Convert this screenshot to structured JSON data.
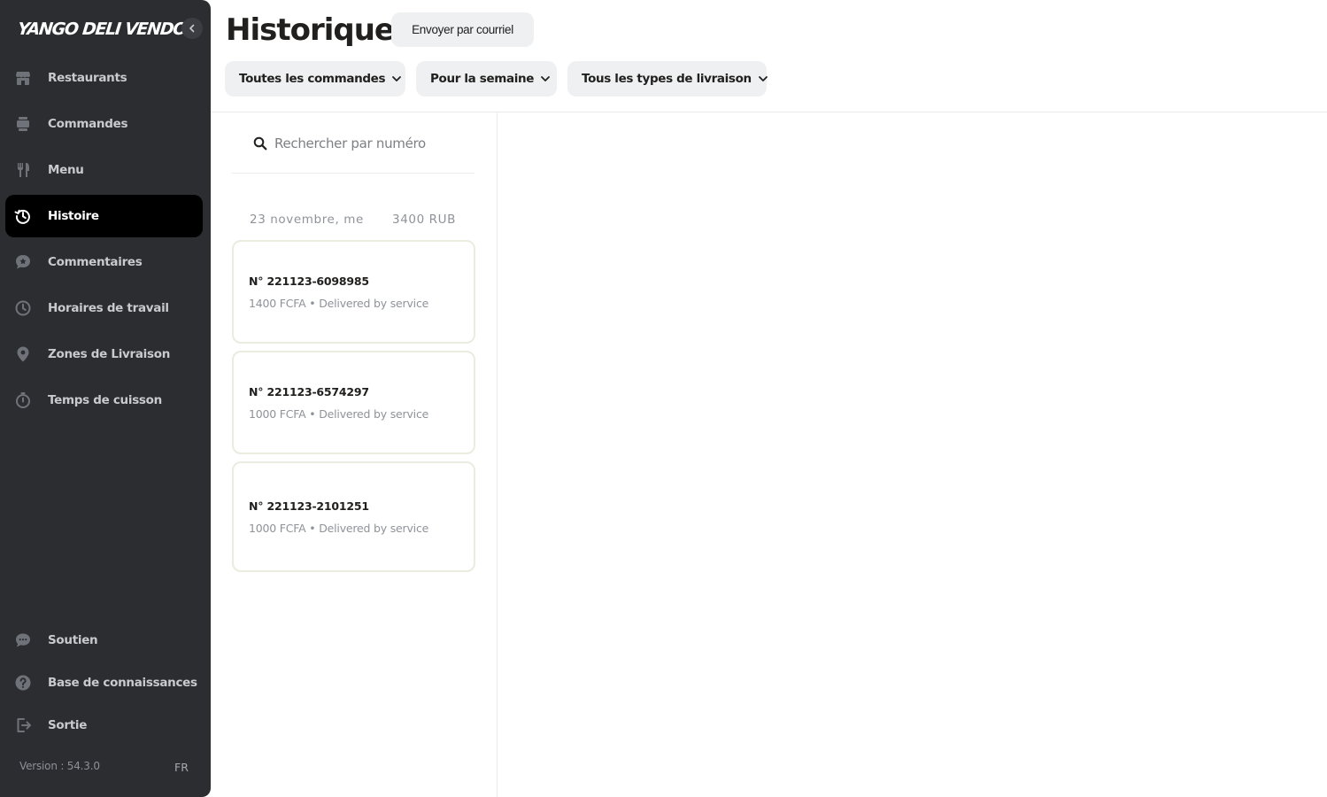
{
  "sidebar": {
    "brand": "YANGO DELI VENDOR",
    "items": [
      {
        "label": "Restaurants",
        "icon": "store-icon"
      },
      {
        "label": "Commandes",
        "icon": "orders-stack-icon"
      },
      {
        "label": "Menu",
        "icon": "fork-knife-icon"
      },
      {
        "label": "Histoire",
        "icon": "history-icon",
        "active": true
      },
      {
        "label": "Commentaires",
        "icon": "comment-star-icon"
      },
      {
        "label": "Horaires de travail",
        "icon": "clock-icon"
      },
      {
        "label": "Zones de Livraison",
        "icon": "location-pin-icon"
      },
      {
        "label": "Temps de cuisson",
        "icon": "stopwatch-icon"
      }
    ],
    "bottom_items": [
      {
        "label": "Soutien",
        "icon": "chat-bubble-icon"
      },
      {
        "label": "Base de connaissances",
        "icon": "help-circle-icon"
      },
      {
        "label": "Sortie",
        "icon": "logout-icon"
      }
    ],
    "version": "Version : 54.3.0",
    "language": "FR"
  },
  "header": {
    "title": "Historique",
    "email_button": "Envoyer par courriel",
    "filters": [
      "Toutes les commandes",
      "Pour la semaine",
      "Tous les types de livraison"
    ]
  },
  "search": {
    "placeholder": "Rechercher par numéro",
    "value": ""
  },
  "group": {
    "date": "23 novembre, me",
    "total": "3400 RUB"
  },
  "orders": [
    {
      "number": "N° 221123-6098985",
      "amount": "1400 FCFA",
      "delivery": "• Delivered by service"
    },
    {
      "number": "N° 221123-6574297",
      "amount": "1000 FCFA",
      "delivery": "• Delivered by service"
    },
    {
      "number": "N° 221123-2101251",
      "amount": "1000 FCFA",
      "delivery": "• Delivered by service"
    }
  ],
  "colors": {
    "sidebar_bg": "#2b2d31",
    "active_item_bg": "#000000",
    "filter_bg": "#eef0f1",
    "card_border": "#ecebe0"
  }
}
